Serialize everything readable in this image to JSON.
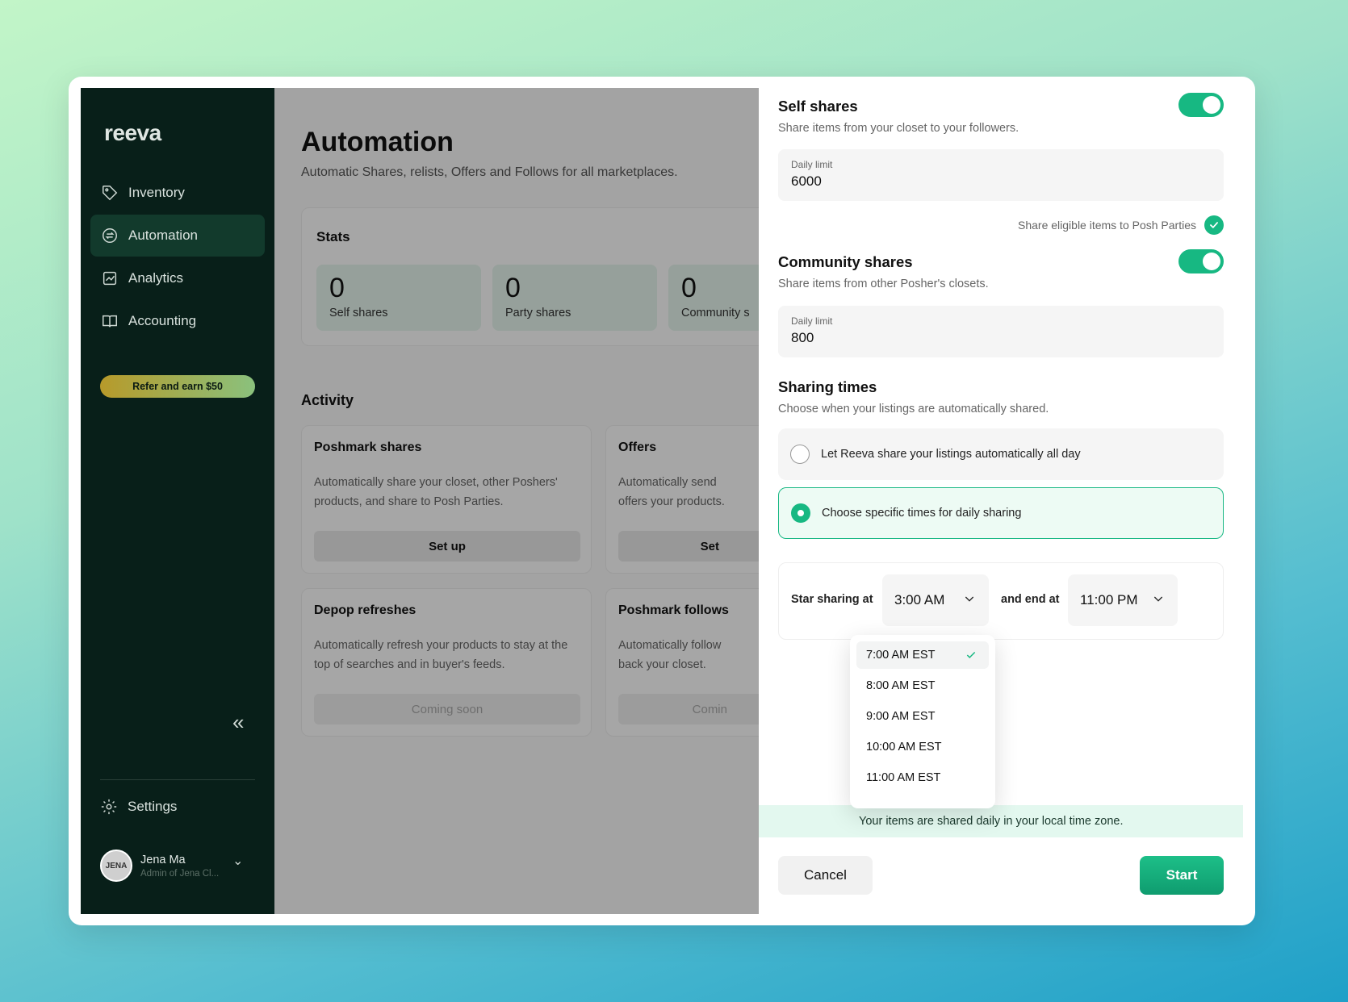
{
  "app": {
    "brand": "reeva"
  },
  "sidebar": {
    "items": [
      {
        "label": "Inventory",
        "icon": "tag-icon"
      },
      {
        "label": "Automation",
        "icon": "sync-icon",
        "active": true
      },
      {
        "label": "Analytics",
        "icon": "chart-icon"
      },
      {
        "label": "Accounting",
        "icon": "book-icon"
      }
    ],
    "refer_label": "Refer and earn $50",
    "settings_label": "Settings",
    "user": {
      "name": "Jena Ma",
      "role": "Admin of Jena Cl...",
      "avatar_text": "JENA"
    }
  },
  "main": {
    "title": "Automation",
    "subtitle": "Automatic Shares, relists, Offers and Follows for all marketplaces.",
    "stats_title": "Stats",
    "stats": [
      {
        "value": "0",
        "label": "Self shares"
      },
      {
        "value": "0",
        "label": "Party shares"
      },
      {
        "value": "0",
        "label": "Community s"
      }
    ],
    "activity_title": "Activity",
    "cards": [
      {
        "title": "Poshmark shares",
        "desc": "Automatically share your closet, other Poshers' products, and share to Posh Parties.",
        "button": "Set up"
      },
      {
        "title": "Offers",
        "desc": "Automatically send offers your products.",
        "button": "Set"
      },
      {
        "title": "Depop refreshes",
        "desc": "Automatically refresh your products to stay at the top of searches and in buyer's feeds.",
        "button": "Coming soon"
      },
      {
        "title": "Poshmark follows",
        "desc": "Automatically follow back your closet.",
        "button": "Comin"
      }
    ]
  },
  "panel": {
    "self_shares": {
      "title": "Self shares",
      "desc": "Share items from your closet to your followers.",
      "enabled": true,
      "limit_label": "Daily limit",
      "limit_value": "6000",
      "posh_parties_label": "Share eligible items to Posh Parties"
    },
    "community_shares": {
      "title": "Community shares",
      "desc": "Share items from other Posher's closets.",
      "enabled": true,
      "limit_label": "Daily limit",
      "limit_value": "800"
    },
    "sharing_times": {
      "title": "Sharing times",
      "desc": "Choose when your listings are automatically shared.",
      "option_all_day": "Let Reeva share your listings automatically all day",
      "option_specific": "Choose specific times for daily sharing",
      "start_label": "Star sharing at",
      "start_value": "3:00 AM",
      "end_label": "and end at",
      "end_value": "11:00 PM",
      "dropdown_options": [
        "7:00 AM EST",
        "8:00 AM EST",
        "9:00 AM EST",
        "10:00 AM EST",
        "11:00 AM EST"
      ],
      "dropdown_selected": "7:00 AM EST"
    },
    "notice": "Your items are shared daily in your local time zone.",
    "cancel_label": "Cancel",
    "start_label": "Start"
  },
  "colors": {
    "accent": "#17b882",
    "sidebar_bg": "#081f19",
    "notice_bg": "#e3f8ef"
  }
}
